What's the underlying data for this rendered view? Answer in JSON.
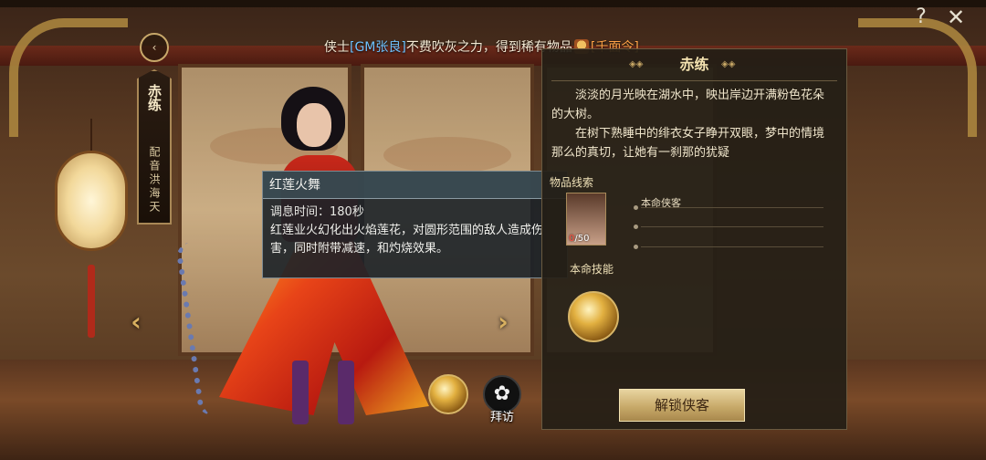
{
  "broadcast": {
    "prefix": "侠士",
    "gm_name": "[GM张良]",
    "middle": "不费吹灰之力，得到稀有物品",
    "item": "[千面令]"
  },
  "top_controls": {
    "help_icon": "?",
    "close_icon": "✕"
  },
  "character": {
    "name": "赤练",
    "voice": "配音洪海天"
  },
  "nav": {
    "prev": "‹",
    "next": "›"
  },
  "tooltip": {
    "title": "红莲火舞",
    "cooldown": "调息时间：180秒",
    "description": "红莲业火幻化出火焰莲花，对圆形范围的敌人造成伤害，同时附带减速，和灼烧效果。"
  },
  "visit": {
    "label": "拜访",
    "icon": "flower-icon"
  },
  "panel": {
    "title": "赤练",
    "story": [
      "淡淡的月光映在湖水中，映出岸边开满粉色花朵的大树。",
      "在树下熟睡中的绯衣女子睁开双眼，梦中的情境那么的真切，让她有一刹那的犹疑"
    ],
    "clue_label": "物品线索",
    "clue_current": "0",
    "clue_total": "/50",
    "clue_entry": "本命侠客",
    "skill_label": "本命技能",
    "unlock_button": "解锁侠客"
  },
  "colors": {
    "gm": "#6fc3ff",
    "item": "#ffa347",
    "accent_gold": "#c8a866"
  }
}
